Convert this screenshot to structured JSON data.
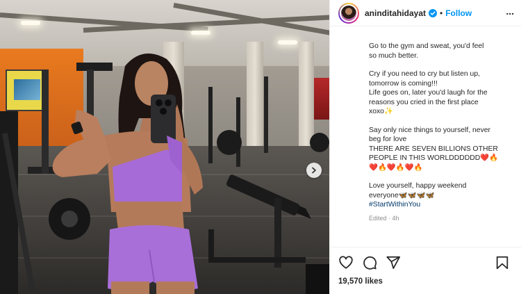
{
  "post": {
    "username": "aninditahidayat",
    "verified": true,
    "separator": "•",
    "follow_label": "Follow",
    "more_label": "...",
    "caption": {
      "paragraphs": [
        [
          "Go to the gym and sweat, you'd feel",
          "so much better."
        ],
        [
          "Cry if you need to cry but listen up,",
          "tomorrow is coming!!!",
          "Life goes on, later you'd laugh for the",
          "reasons you cried in the first place",
          "xoxo✨"
        ],
        [
          "Say only nice things to yourself, never",
          "beg for love",
          "THERE ARE SEVEN BILLIONS OTHER",
          "PEOPLE IN THIS WORLDDDDDD❤️🔥",
          "❤️🔥❤️🔥❤️🔥"
        ],
        [
          "Love yourself, happy weekend",
          "everyone🦋🦋🦋🦋"
        ]
      ],
      "hashtag": "#StartWithinYou"
    },
    "edited_label": "Edited · 4h",
    "likes_label": "19,570 likes"
  },
  "icons": {
    "like": "heart-icon",
    "comment": "comment-icon",
    "share": "share-icon",
    "save": "bookmark-icon",
    "verified": "verified-badge-icon",
    "carousel_next": "chevron-right-icon"
  },
  "colors": {
    "follow": "#0095f6",
    "hashtag": "#00376b",
    "verified": "#0095f6",
    "outfit": "#a66bd6"
  }
}
